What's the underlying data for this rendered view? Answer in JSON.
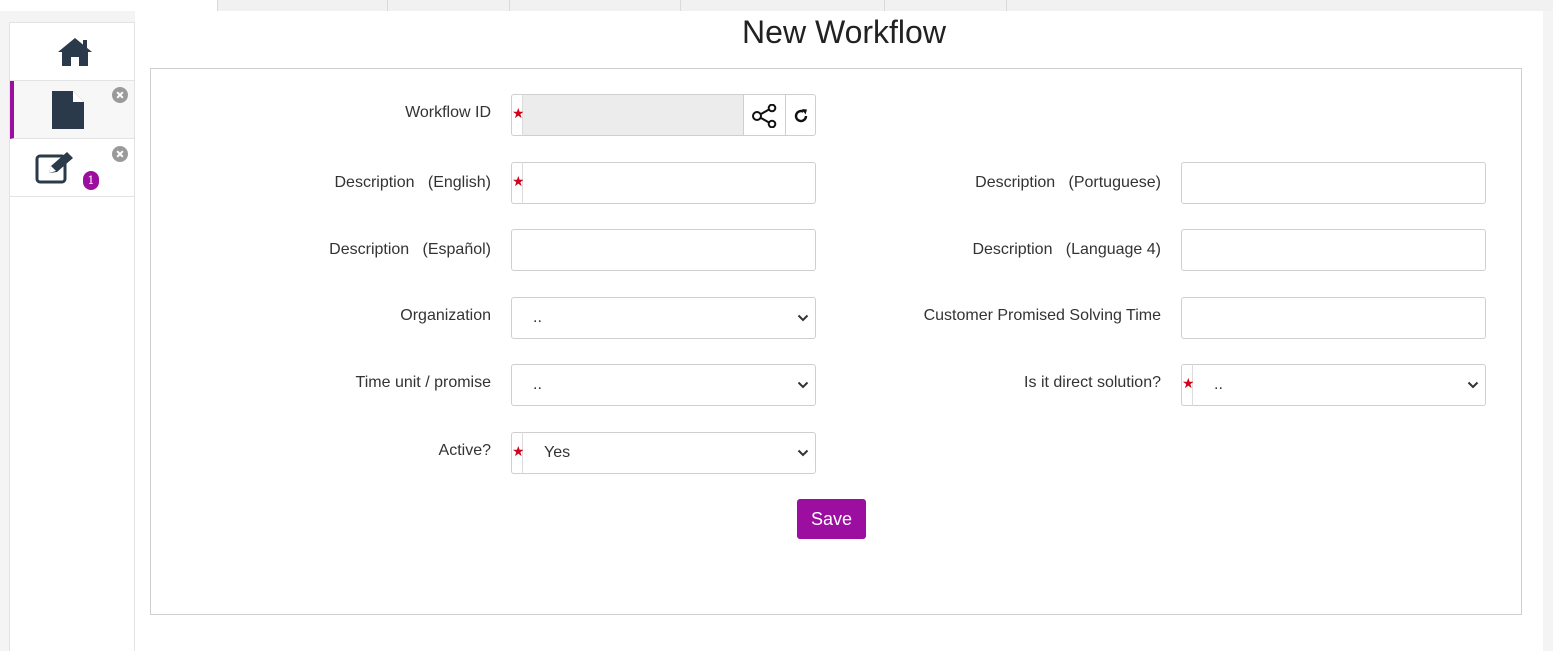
{
  "page": {
    "title": "New Workflow"
  },
  "sidebar": {
    "items": [
      {
        "icon": "home-icon"
      },
      {
        "icon": "file-icon",
        "active": true
      },
      {
        "icon": "edit-icon",
        "badge": "1"
      }
    ]
  },
  "form": {
    "workflow_id": {
      "label": "Workflow ID",
      "value": "",
      "required": true
    },
    "desc_english": {
      "label": "Description   (English)",
      "value": "",
      "required": true
    },
    "desc_portuguese": {
      "label": "Description   (Portuguese)",
      "value": ""
    },
    "desc_espanol": {
      "label": "Description   (Español)",
      "value": ""
    },
    "desc_lang4": {
      "label": "Description   (Language 4)",
      "value": ""
    },
    "organization": {
      "label": "Organization",
      "value": ".."
    },
    "promised_time": {
      "label": "Customer Promised Solving Time",
      "value": ""
    },
    "time_unit": {
      "label": "Time unit / promise",
      "value": ".."
    },
    "direct_solution": {
      "label": "Is it direct solution?",
      "value": "..",
      "required": true
    },
    "active": {
      "label": "Active?",
      "value": "Yes",
      "required": true
    },
    "save_label": "Save"
  },
  "colors": {
    "accent": "#9c0ea0",
    "required_star": "#d0021b"
  }
}
